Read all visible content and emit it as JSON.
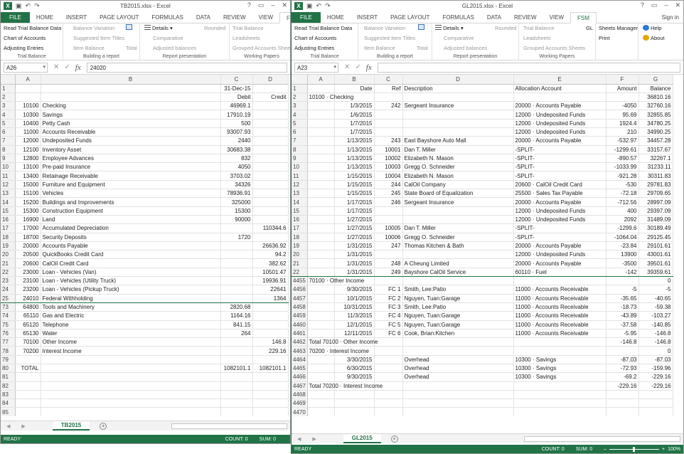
{
  "w1": {
    "title": "TB2015.xlsx - Excel",
    "namebox": "A26",
    "formula": "24020",
    "sheet_tab": "TB2015",
    "status": {
      "ready": "READY",
      "count": "COUNT: 0",
      "sum": "SUM: 0"
    },
    "cols": [
      "A",
      "B",
      "C",
      "D"
    ],
    "rows": [
      [
        "1",
        "",
        "",
        "31-Dec-15",
        ""
      ],
      [
        "2",
        "",
        "",
        "Debit",
        "Credit"
      ],
      [
        "3",
        "10100",
        "Checking",
        "46969.1",
        ""
      ],
      [
        "4",
        "10300",
        "Savings",
        "17910.19",
        ""
      ],
      [
        "5",
        "10400",
        "Petty Cash",
        "500",
        ""
      ],
      [
        "6",
        "11000",
        "Accounts Receivable",
        "93007.93",
        ""
      ],
      [
        "7",
        "12000",
        "Undeposited Funds",
        "2440",
        ""
      ],
      [
        "8",
        "12100",
        "Inventory Asset",
        "30683.38",
        ""
      ],
      [
        "9",
        "12800",
        "Employee Advances",
        "832",
        ""
      ],
      [
        "10",
        "13100",
        "Pre-paid Insurance",
        "4050",
        ""
      ],
      [
        "11",
        "13400",
        "Retainage Receivable",
        "3703.02",
        ""
      ],
      [
        "12",
        "15000",
        "Furniture and Equipment",
        "34326",
        ""
      ],
      [
        "13",
        "15100",
        "Vehicles",
        "78936.91",
        ""
      ],
      [
        "14",
        "15200",
        "Buildings and Improvements",
        "325000",
        ""
      ],
      [
        "15",
        "15300",
        "Construction Equipment",
        "15300",
        ""
      ],
      [
        "16",
        "16900",
        "Land",
        "90000",
        ""
      ],
      [
        "17",
        "17000",
        "Accumulated Depreciation",
        "",
        "110344.6"
      ],
      [
        "18",
        "18700",
        "Security Deposits",
        "1720",
        ""
      ],
      [
        "19",
        "20000",
        "Accounts Payable",
        "",
        "26636.92"
      ],
      [
        "20",
        "20500",
        "QuickBooks Credit Card",
        "",
        "94.2"
      ],
      [
        "21",
        "20600",
        "CalOil Credit Card",
        "",
        "382.62"
      ],
      [
        "22",
        "23000",
        "Loan - Vehicles (Van)",
        "",
        "10501.47"
      ],
      [
        "23",
        "23100",
        "Loan - Vehicles (Utility Truck)",
        "",
        "19936.91"
      ],
      [
        "24",
        "23200",
        "Loan - Vehicles (Pickup Truck)",
        "",
        "22641"
      ],
      [
        "25",
        "24010",
        "Federal Withholding",
        "",
        "1364"
      ],
      [
        "73",
        "64800",
        "Tools and Machinery",
        "2820.68",
        ""
      ],
      [
        "74",
        "65110",
        "Gas and Electric",
        "1164.16",
        ""
      ],
      [
        "75",
        "65120",
        "Telephone",
        "841.15",
        ""
      ],
      [
        "76",
        "65130",
        "Water",
        "264",
        ""
      ],
      [
        "77",
        "70100",
        "Other Income",
        "",
        "146.8"
      ],
      [
        "78",
        "70200",
        "Interest Income",
        "",
        "229.16"
      ],
      [
        "79",
        "",
        "",
        "",
        ""
      ],
      [
        "80",
        "TOTAL",
        "",
        "1082101.1",
        "1082101.1"
      ],
      [
        "81",
        "",
        "",
        "",
        ""
      ],
      [
        "82",
        "",
        "",
        "",
        ""
      ],
      [
        "83",
        "",
        "",
        "",
        ""
      ],
      [
        "84",
        "",
        "",
        "",
        ""
      ],
      [
        "85",
        "",
        "",
        "",
        ""
      ]
    ]
  },
  "w2": {
    "title": "GL2015.xlsx - Excel",
    "namebox": "A23",
    "formula": "",
    "sheet_tab": "GL2015",
    "status": {
      "ready": "READY",
      "count": "COUNT: 0",
      "sum": "SUM: 0",
      "zoom": "100%"
    },
    "cols": [
      "A",
      "B",
      "C",
      "D",
      "E",
      "F",
      "G"
    ],
    "rows": [
      [
        "1",
        "",
        "Date",
        "Ref",
        "Description",
        "Allocation Account",
        "Amount",
        "Balance"
      ],
      [
        "2",
        "10100 · Checking",
        "",
        "",
        "",
        "",
        "",
        "36810.16"
      ],
      [
        "3",
        "",
        "1/3/2015",
        "242",
        "Sergeant Insurance",
        "20000 · Accounts Payable",
        "-4050",
        "32760.16"
      ],
      [
        "4",
        "",
        "1/6/2015",
        "",
        "",
        "12000 · Undeposited Funds",
        "95.69",
        "32855.85"
      ],
      [
        "5",
        "",
        "1/7/2015",
        "",
        "",
        "12000 · Undeposited Funds",
        "1924.4",
        "34780.25"
      ],
      [
        "6",
        "",
        "1/7/2015",
        "",
        "",
        "12000 · Undeposited Funds",
        "210",
        "34990.25"
      ],
      [
        "7",
        "",
        "1/13/2015",
        "243",
        "East Bayshore Auto Mall",
        "20000 · Accounts Payable",
        "-532.97",
        "34457.28"
      ],
      [
        "8",
        "",
        "1/13/2015",
        "10001",
        "Dan T. Miller",
        "-SPLIT-",
        "-1299.61",
        "33157.67"
      ],
      [
        "9",
        "",
        "1/13/2015",
        "10002",
        "Elizabeth N. Mason",
        "-SPLIT-",
        "-890.57",
        "32267.1"
      ],
      [
        "10",
        "",
        "1/13/2015",
        "10003",
        "Gregg O. Schneider",
        "-SPLIT-",
        "-1033.99",
        "31233.11"
      ],
      [
        "11",
        "",
        "1/15/2015",
        "10004",
        "Elizabeth N. Mason",
        "-SPLIT-",
        "-921.28",
        "30311.83"
      ],
      [
        "12",
        "",
        "1/15/2015",
        "244",
        "CalOil Company",
        "20600 · CalOil Credit Card",
        "-530",
        "29781.83"
      ],
      [
        "13",
        "",
        "1/15/2015",
        "245",
        "State Board of Equalization",
        "25500 · Sales Tax Payable",
        "-72.18",
        "29709.65"
      ],
      [
        "14",
        "",
        "1/17/2015",
        "246",
        "Sergeant Insurance",
        "20000 · Accounts Payable",
        "-712.56",
        "28997.09"
      ],
      [
        "15",
        "",
        "1/17/2015",
        "",
        "",
        "12000 · Undeposited Funds",
        "400",
        "29397.09"
      ],
      [
        "16",
        "",
        "1/27/2015",
        "",
        "",
        "12000 · Undeposited Funds",
        "2092",
        "31489.09"
      ],
      [
        "17",
        "",
        "1/27/2015",
        "10005",
        "Dan T. Miller",
        "-SPLIT-",
        "-1299.6",
        "30189.49"
      ],
      [
        "18",
        "",
        "1/27/2015",
        "10006",
        "Gregg O. Schneider",
        "-SPLIT-",
        "-1064.04",
        "29125.45"
      ],
      [
        "19",
        "",
        "1/31/2015",
        "247",
        "Thomas Kitchen & Bath",
        "20000 · Accounts Payable",
        "-23.84",
        "29101.61"
      ],
      [
        "20",
        "",
        "1/31/2015",
        "",
        "",
        "12000 · Undeposited Funds",
        "13900",
        "43001.61"
      ],
      [
        "21",
        "",
        "1/31/2015",
        "248",
        "A Cheung Limited",
        "20000 · Accounts Payable",
        "-3500",
        "39501.61"
      ],
      [
        "22",
        "",
        "1/31/2015",
        "249",
        "Bayshore CalOil Service",
        "60110 · Fuel",
        "-142",
        "39359.61"
      ],
      [
        "4455",
        "70100 · Other Income",
        "",
        "",
        "",
        "",
        "",
        "0"
      ],
      [
        "4456",
        "",
        "9/30/2015",
        "FC 1",
        "Smith, Lee:Patio",
        "11000 · Accounts Receivable",
        "-5",
        "-5"
      ],
      [
        "4457",
        "",
        "10/1/2015",
        "FC 2",
        "Nguyen, Tuan:Garage",
        "11000 · Accounts Receivable",
        "-35.65",
        "-40.65"
      ],
      [
        "4458",
        "",
        "10/31/2015",
        "FC 3",
        "Smith, Lee:Patio",
        "11000 · Accounts Receivable",
        "-18.73",
        "-59.38"
      ],
      [
        "4459",
        "",
        "11/3/2015",
        "FC 4",
        "Nguyen, Tuan:Garage",
        "11000 · Accounts Receivable",
        "-43.89",
        "-103.27"
      ],
      [
        "4460",
        "",
        "12/1/2015",
        "FC 5",
        "Nguyen, Tuan:Garage",
        "11000 · Accounts Receivable",
        "-37.58",
        "-140.85"
      ],
      [
        "4461",
        "",
        "12/11/2015",
        "FC 6",
        "Cook, Brian:Kitchen",
        "11000 · Accounts Receivable",
        "-5.95",
        "-146.8"
      ],
      [
        "4462",
        "Total 70100 · Other Income",
        "",
        "",
        "",
        "",
        "-146.8",
        "-146.8"
      ],
      [
        "4463",
        "70200 · Interest Income",
        "",
        "",
        "",
        "",
        "",
        "0"
      ],
      [
        "4464",
        "",
        "3/30/2015",
        "",
        "Overhead",
        "10300 · Savings",
        "-87.03",
        "-87.03"
      ],
      [
        "4465",
        "",
        "6/30/2015",
        "",
        "Overhead",
        "10300 · Savings",
        "-72.93",
        "-159.96"
      ],
      [
        "4466",
        "",
        "9/30/2015",
        "",
        "Overhead",
        "10300 · Savings",
        "-69.2",
        "-229.16"
      ],
      [
        "4467",
        "Total 70200 · Interest Income",
        "",
        "",
        "",
        "",
        "-229.16",
        "-229.16"
      ],
      [
        "4468",
        "",
        "",
        "",
        "",
        "",
        "",
        ""
      ],
      [
        "4469",
        "",
        "",
        "",
        "",
        "",
        "",
        ""
      ],
      [
        "4470",
        "",
        "",
        "",
        "",
        "",
        "",
        ""
      ]
    ]
  },
  "tabs": [
    "FILE",
    "HOME",
    "INSERT",
    "PAGE LAYOUT",
    "FORMULAS",
    "DATA",
    "REVIEW",
    "VIEW",
    "FSM"
  ],
  "signin": "Sign in",
  "ribbon": {
    "read_tb": "Read Trial Balance Data",
    "coa": "Chart of Accounts",
    "adj": "Adjusting Entries",
    "g1": "Trial Balance",
    "bal_var": "Balance Variation",
    "sugg": "Suggested Item Titles",
    "item_bal": "Item Balance",
    "total": "Total",
    "g2": "Building a report",
    "details": "Details",
    "rounded": "Rounded",
    "comparative": "Comparative",
    "adj_bal": "Adjusted balances",
    "g3": "Report presentation",
    "tb": "Trial Balance",
    "leadsheets": "Leadsheets",
    "grouped": "Grouped Accounts Sheets",
    "g4": "Working Papers",
    "gl": "GL",
    "sheets_mgr": "Sheets Manager",
    "print": "Print",
    "help": "Help",
    "about": "About"
  }
}
